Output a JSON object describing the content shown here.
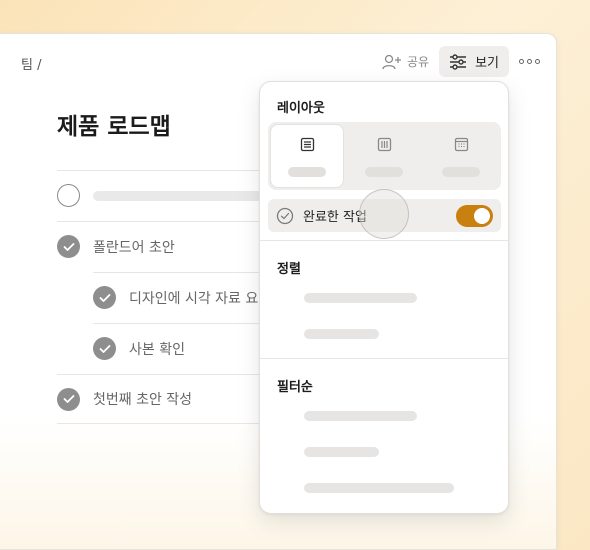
{
  "breadcrumb": "팀 /",
  "toolbar": {
    "share_label": "공유",
    "view_label": "보기"
  },
  "page_title": "제품 로드맵",
  "tasks": [
    {
      "label": "",
      "done": false
    },
    {
      "label": "폴란드어 초안",
      "done": true
    },
    {
      "label": "디자인에 시각 자료 요",
      "done": true
    },
    {
      "label": "사본 확인",
      "done": true
    },
    {
      "label": "첫번째 초안 작성",
      "done": true
    }
  ],
  "view_menu": {
    "layout_title": "레이아웃",
    "layout_options": [
      "list",
      "board",
      "calendar"
    ],
    "selected_layout": "list",
    "completed_tasks_label": "완료한 작업",
    "completed_tasks_enabled": true,
    "sort_title": "정렬",
    "filter_title": "필터순"
  },
  "colors": {
    "accent": "#c8800f",
    "check": "#8e8e8e"
  }
}
